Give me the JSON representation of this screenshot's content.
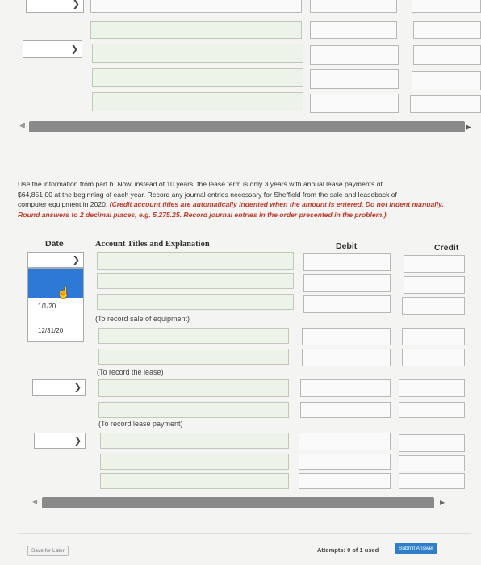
{
  "instructions": {
    "line1": "Use the information from part b. Now, instead of 10 years, the lease term is only 3 years with annual lease payments of",
    "line2": "$64,851.00 at the beginning of each year. Record any journal entries necessary for Sheffield from the sale and leaseback of",
    "line3_normal": "computer equipment in 2020. ",
    "line3_red": "(Credit account titles are automatically indented when the amount is entered. Do not indent manually.",
    "line4_red": "Round answers to 2 decimal places, e.g. 5,275.25. Record journal entries in the order presented in the problem.)"
  },
  "table": {
    "headers": {
      "date": "Date",
      "account": "Account Titles and Explanation",
      "debit": "Debit",
      "credit": "Credit"
    },
    "date_options": [
      "1/1/20",
      "12/31/20"
    ],
    "notes": {
      "sale": "(To record sale of equipment)",
      "lease": "(To record the lease)",
      "payment": "(To record lease payment)"
    }
  },
  "footer": {
    "save_label": "Save for Later",
    "attempts_label": "Attempts: 0 of 1 used",
    "submit_label": "Submit Answer"
  },
  "icons": {
    "chevron_down": "chevron-down-icon",
    "arrow_left": "arrow-left-icon",
    "arrow_right": "arrow-right-icon",
    "cursor": "hand-cursor-icon"
  }
}
